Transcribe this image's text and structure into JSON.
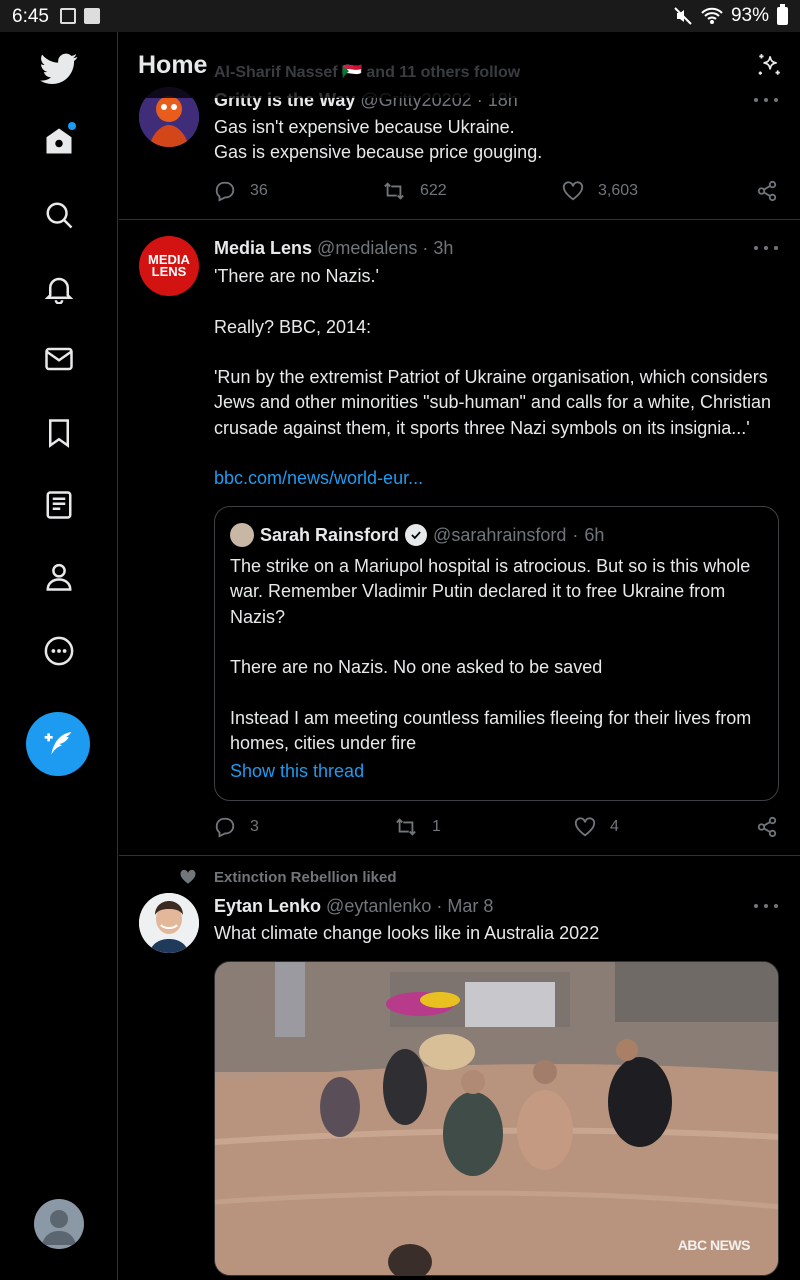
{
  "status_bar": {
    "time": "6:45",
    "battery": "93%"
  },
  "header": {
    "title": "Home",
    "ghost_text": "Al-Sharif Nassef 🇸🇩 and 11 others follow"
  },
  "tweets": [
    {
      "name": "Gritty is the Way",
      "handle": "@Gritty20202",
      "time": "18h",
      "text": "Gas isn't expensive because Ukraine.\nGas is expensive because price gouging.",
      "replies": "36",
      "retweets": "622",
      "likes": "3,603"
    },
    {
      "name": "Media Lens",
      "handle": "@medialens",
      "time": "3h",
      "avatar_text": "MEDIA LENS",
      "text": "'There are no Nazis.'\n\nReally? BBC, 2014:\n\n'Run by the extremist Patriot of Ukraine organisation, which considers Jews and other minorities \"sub-human\" and calls for a white, Christian crusade against them, it sports three Nazi symbols on its insignia...'",
      "link": "bbc.com/news/world-eur...",
      "quote": {
        "name": "Sarah Rainsford",
        "handle": "@sarahrainsford",
        "time": "6h",
        "text": "The strike on a Mariupol hospital is atrocious. But so is this whole war. Remember Vladimir Putin declared it to free Ukraine from Nazis?\n\nThere are no Nazis. No one asked to be saved\n\nInstead I am meeting countless families fleeing for their lives from homes, cities under fire",
        "show_thread": "Show this thread"
      },
      "replies": "3",
      "retweets": "1",
      "likes": "4"
    },
    {
      "social_context": "Extinction Rebellion liked",
      "name": "Eytan Lenko",
      "handle": "@eytanlenko",
      "time": "Mar 8",
      "text": "What climate change looks like in Australia 2022",
      "media_badge": "ABC NEWS"
    }
  ],
  "colors": {
    "accent": "#1d9bf0",
    "background": "#000000",
    "muted": "#71767b",
    "border": "#2f3336"
  },
  "icons": [
    "twitter-logo-icon",
    "home-icon",
    "search-icon",
    "notifications-bell-icon",
    "messages-envelope-icon",
    "bookmark-icon",
    "lists-icon",
    "profile-icon",
    "more-circle-icon",
    "compose-tweet-icon",
    "sparkle-icon",
    "reply-icon",
    "retweet-icon",
    "like-heart-icon",
    "share-icon"
  ]
}
